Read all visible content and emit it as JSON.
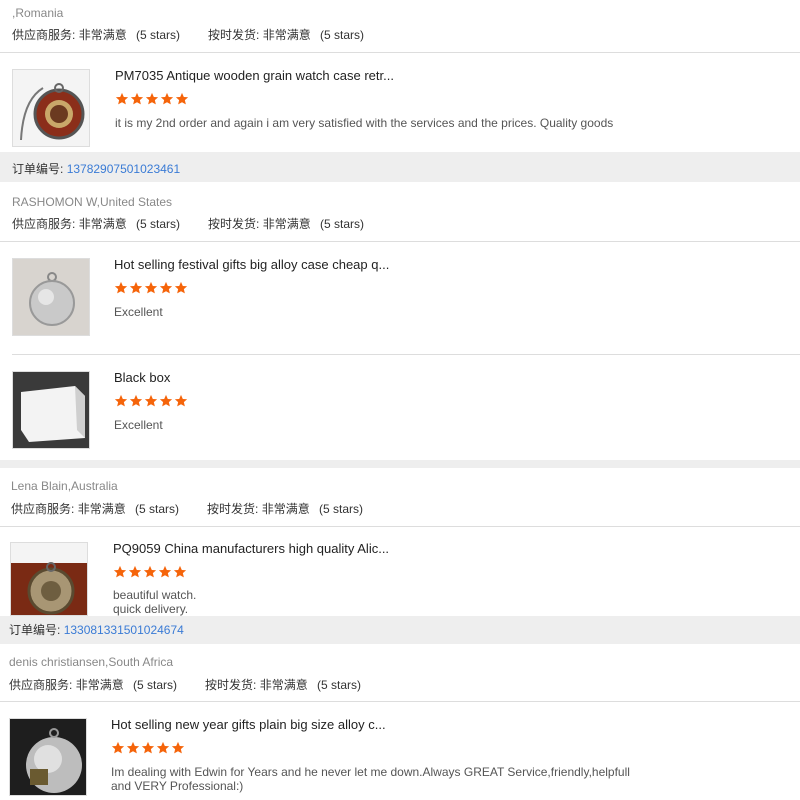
{
  "header": {
    "buyer": ",Romania",
    "supplier_service_label": "供应商服务:",
    "supplier_service_value": "非常满意",
    "supplier_service_stars": "(5 stars)",
    "ontime_label": "按时发货:",
    "ontime_value": "非常满意",
    "ontime_stars": "(5 stars)"
  },
  "reviews": [
    {
      "product": "PM7035 Antique wooden grain watch case retr...",
      "rating": 5,
      "text": "it is my 2nd order and again i am very satisfied with the services and the prices. Quality goods"
    }
  ],
  "order1": {
    "label": "订单编号:",
    "number": "13782907501023461"
  },
  "group2": {
    "buyer": "RASHOMON W,United States",
    "supplier_service_label": "供应商服务:",
    "supplier_service_value": "非常满意",
    "supplier_service_stars": "(5 stars)",
    "ontime_label": "按时发货:",
    "ontime_value": "非常满意",
    "ontime_stars": "(5 stars)",
    "items": [
      {
        "product": "Hot selling festival gifts big alloy case cheap q...",
        "rating": 5,
        "text": "Excellent"
      },
      {
        "product": "Black box",
        "rating": 5,
        "text": "Excellent"
      }
    ]
  },
  "group3": {
    "buyer": "Lena Blain,Australia",
    "supplier_service_label": "供应商服务:",
    "supplier_service_value": "非常满意",
    "supplier_service_stars": "(5 stars)",
    "ontime_label": "按时发货:",
    "ontime_value": "非常满意",
    "ontime_stars": "(5 stars)",
    "item": {
      "product": "PQ9059 China manufacturers high quality Alic...",
      "rating": 5,
      "text_line1": "beautiful watch.",
      "text_line2": "quick delivery."
    }
  },
  "order3": {
    "label": "订单编号:",
    "number": "1330813315010246​74"
  },
  "group4": {
    "buyer": "denis christiansen,South Africa",
    "supplier_service_label": "供应商服务:",
    "supplier_service_value": "非常满意",
    "supplier_service_stars": "(5 stars)",
    "ontime_label": "按时发货:",
    "ontime_value": "非常满意",
    "ontime_stars": "(5 stars)",
    "item": {
      "product": "Hot selling new year gifts plain big size alloy c...",
      "rating": 5,
      "text": "Im dealing with Edwin for Years and he never let me down.Always GREAT Service,friendly,helpfull and VERY Professional:)"
    }
  },
  "colors": {
    "star": "#f5640a",
    "link": "#3a7bd5",
    "band": "#eeeeee"
  },
  "icons": {
    "star": "star-icon"
  }
}
